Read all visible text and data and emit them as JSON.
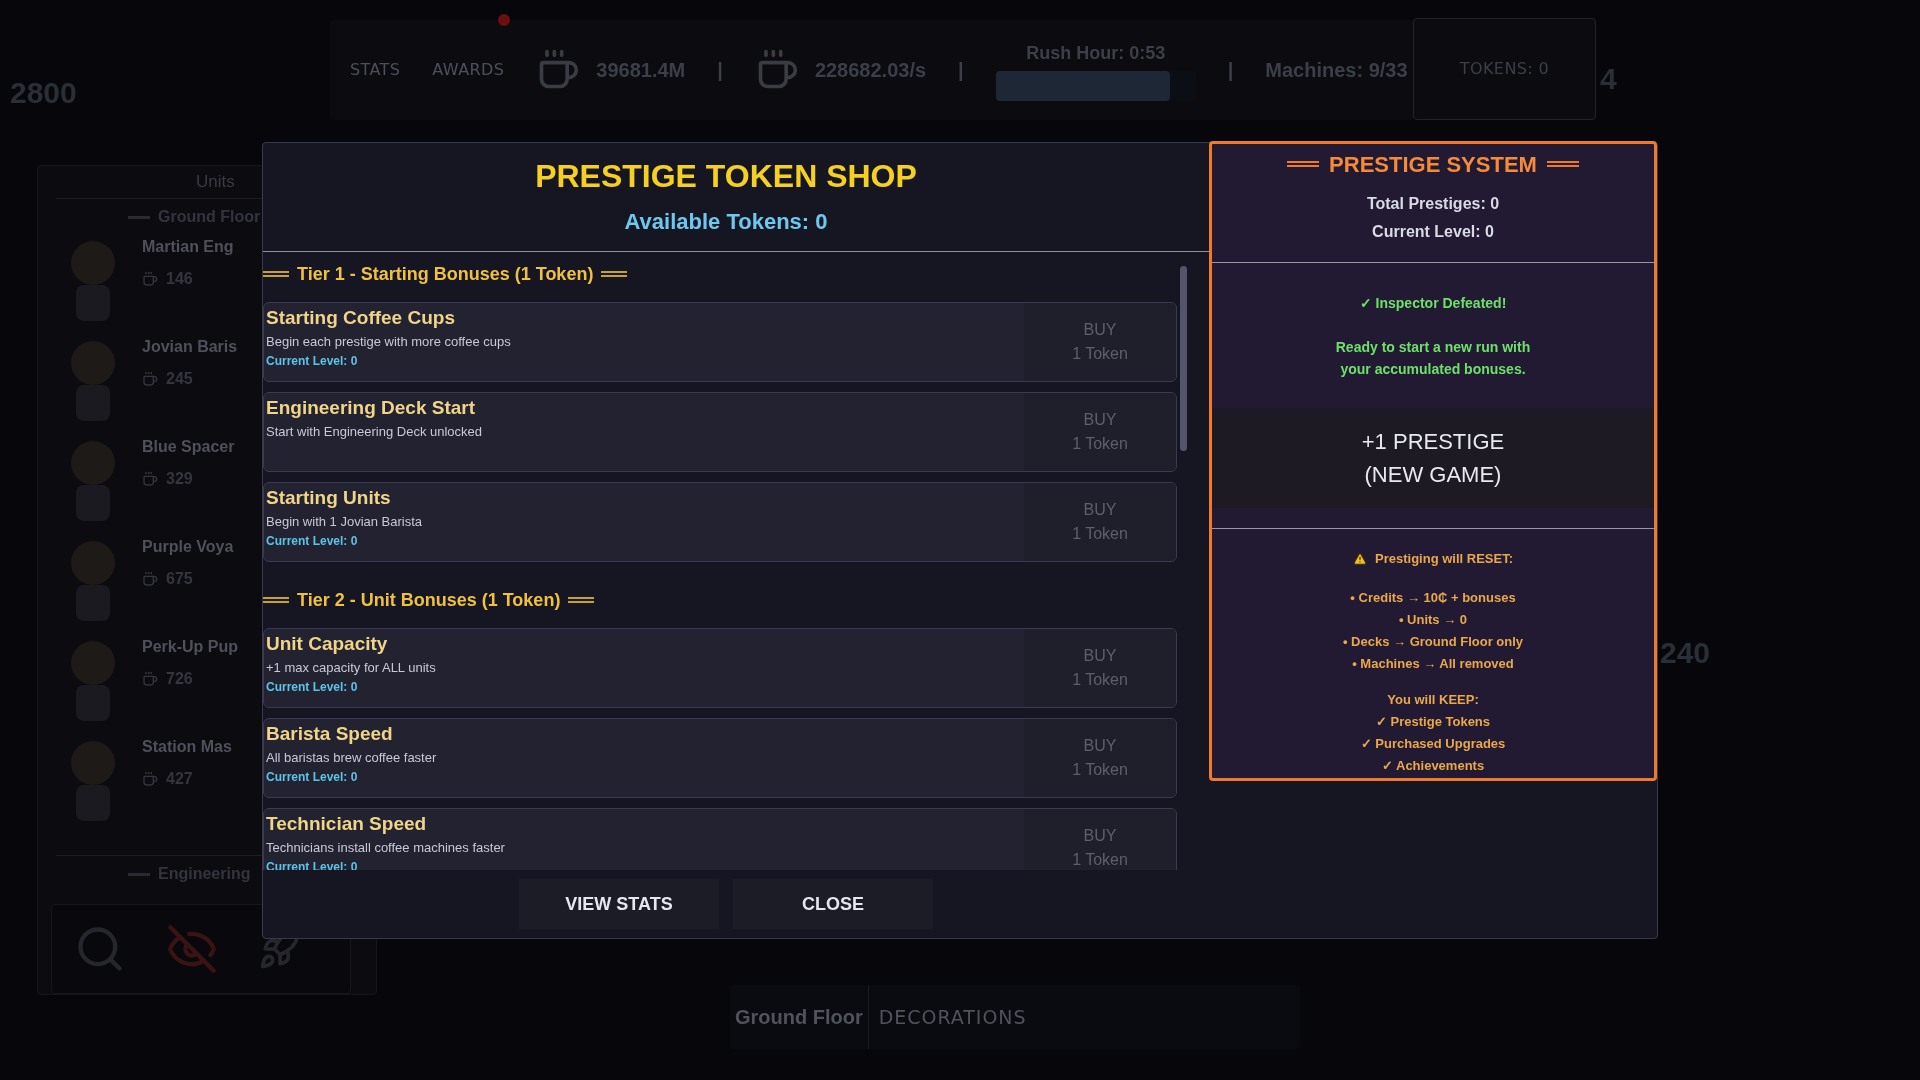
{
  "background_labels": [
    "2800",
    "4",
    "240"
  ],
  "hud": {
    "items": [
      {
        "kind": "link",
        "label": "STATS",
        "badge": false
      },
      {
        "kind": "link",
        "label": "AWARDS",
        "badge": true
      },
      {
        "kind": "currency",
        "value": "39681.4M"
      },
      {
        "kind": "divider",
        "text": "|"
      },
      {
        "kind": "currency",
        "value": "228682.03/s"
      },
      {
        "kind": "divider",
        "text": "|"
      },
      {
        "kind": "timer",
        "label": "Rush Hour: 0:53",
        "level": 0.87
      },
      {
        "kind": "divider",
        "text": "|"
      },
      {
        "kind": "text",
        "label": "Machines: 9/33"
      }
    ],
    "tokens": "TOKENS: 0"
  },
  "units_panel": {
    "title": "Units",
    "sections": [
      {
        "title": "Ground Floor",
        "units": [
          {
            "name": "Martian Eng",
            "cost": "146"
          },
          {
            "name": "Jovian Baris",
            "cost": "245"
          },
          {
            "name": "Blue Spacer",
            "cost": "329"
          },
          {
            "name": "Purple Voya",
            "cost": "675"
          },
          {
            "name": "Perk-Up Pup",
            "cost": "726"
          },
          {
            "name": "Station Mas",
            "cost": "427"
          }
        ]
      },
      {
        "title": "Engineering"
      }
    ]
  },
  "shop": {
    "title": "PRESTIGE TOKEN SHOP",
    "available": "Available Tokens: 0",
    "tiers": [
      {
        "title": "Tier 1 - Starting Bonuses (1 Token)",
        "items": [
          {
            "name": "Starting Coffee Cups",
            "description": "Begin each prestige with more coffee cups",
            "level": "Current Level: 0",
            "buy": "BUY",
            "price": "1 Token",
            "disabled": true
          },
          {
            "name": "Engineering Deck Start",
            "description": "Start with Engineering Deck unlocked",
            "buy": "BUY",
            "price": "1 Token",
            "disabled": true
          },
          {
            "name": "Starting Units",
            "description": "Begin with 1 Jovian Barista",
            "level": "Current Level: 0",
            "buy": "BUY",
            "price": "1 Token",
            "disabled": true
          }
        ]
      },
      {
        "title": "Tier 2 - Unit Bonuses (1 Token)",
        "items": [
          {
            "name": "Unit Capacity",
            "description": "+1 max capacity for ALL units",
            "level": "Current Level: 0",
            "buy": "BUY",
            "price": "1 Token",
            "disabled": true
          },
          {
            "name": "Barista Speed",
            "description": "All baristas brew coffee faster",
            "level": "Current Level: 0",
            "buy": "BUY",
            "price": "1 Token",
            "disabled": true
          },
          {
            "name": "Technician Speed",
            "description": "Technicians install coffee machines faster",
            "level": "Current Level: 0",
            "buy": "BUY",
            "price": "1 Token",
            "disabled": true
          }
        ]
      }
    ],
    "buttons": [
      "VIEW STATS",
      "CLOSE"
    ]
  },
  "prestige": {
    "title": "PRESTIGE SYSTEM",
    "stats": [
      "Total Prestiges: 0",
      "Current Level: 0"
    ],
    "status": "✓ Inspector Defeated!",
    "message": "Ready to start a new run with your accumulated bonuses.",
    "button": [
      "+1 PRESTIGE",
      "(NEW GAME)"
    ],
    "warning": "Prestiging will RESET:",
    "reset": [
      "• Credits → 10₵ + bonuses",
      "• Units → 0",
      "• Decks → Ground Floor only",
      "• Machines → All removed"
    ],
    "keep_title": "You will KEEP:",
    "keep": [
      "✓ Prestige Tokens",
      "✓ Purchased Upgrades",
      "✓ Achievements"
    ]
  },
  "bottom_bar": {
    "floor": "Ground Floor",
    "tab": "DECORATIONS"
  }
}
